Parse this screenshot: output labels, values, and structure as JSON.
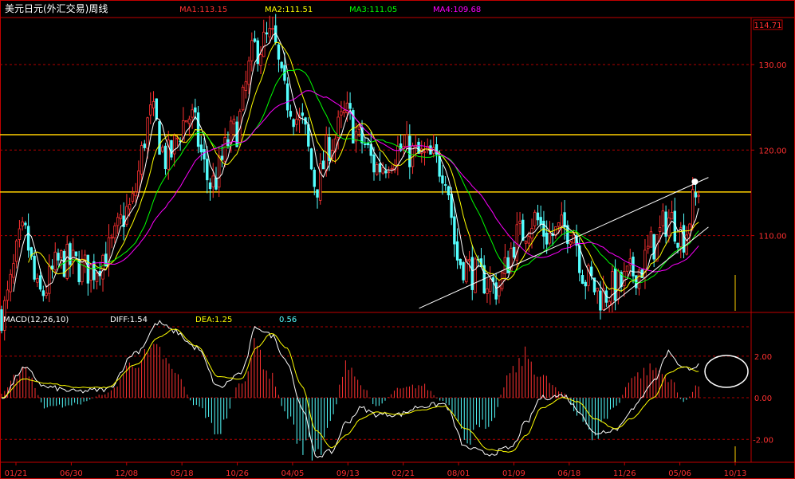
{
  "chart_data": {
    "type": "candlestick",
    "title": "美元日元(外汇交易)周线",
    "moving_averages": [
      {
        "label": "MA1:113.15",
        "value": 113.15,
        "color": "#ffffff"
      },
      {
        "label": "MA2:111.51",
        "value": 111.51,
        "color": "#ffff00"
      },
      {
        "label": "MA3:111.05",
        "value": 111.05,
        "color": "#00ff00"
      },
      {
        "label": "MA4:109.68",
        "value": 109.68,
        "color": "#ff00ff"
      }
    ],
    "price_axis": {
      "ticks": [
        "130.00",
        "120.00",
        "110.00"
      ],
      "tick_values": [
        130,
        120,
        110
      ],
      "ylim": [
        101.2,
        135.5
      ],
      "last_price": "114.71",
      "last_value": 114.71
    },
    "horizontal_lines": [
      121.8,
      115.1
    ],
    "trendlines": [
      {
        "from": [
          0.557,
          101.5
        ],
        "to": [
          0.943,
          116.8
        ]
      },
      {
        "from": [
          0.803,
          101.2
        ],
        "to": [
          0.943,
          111.0
        ]
      }
    ],
    "x_labels": [
      "01/21",
      "06/30",
      "12/08",
      "05/18",
      "10/26",
      "04/05",
      "09/13",
      "02/21",
      "08/01",
      "01/09",
      "06/18",
      "11/26",
      "05/06",
      "10/13"
    ],
    "price_keypoints": [
      [
        0,
        101
      ],
      [
        0.03,
        110
      ],
      [
        0.05,
        103
      ],
      [
        0.08,
        107
      ],
      [
        0.12,
        106
      ],
      [
        0.14,
        108
      ],
      [
        0.17,
        113
      ],
      [
        0.2,
        124
      ],
      [
        0.22,
        119
      ],
      [
        0.25,
        124
      ],
      [
        0.28,
        116
      ],
      [
        0.31,
        122
      ],
      [
        0.34,
        132
      ],
      [
        0.36,
        133
      ],
      [
        0.38,
        126
      ],
      [
        0.4,
        123
      ],
      [
        0.42,
        116
      ],
      [
        0.44,
        121
      ],
      [
        0.46,
        124
      ],
      [
        0.48,
        121
      ],
      [
        0.5,
        118
      ],
      [
        0.53,
        120
      ],
      [
        0.57,
        119
      ],
      [
        0.59,
        118
      ],
      [
        0.61,
        107
      ],
      [
        0.64,
        105
      ],
      [
        0.66,
        104
      ],
      [
        0.69,
        110
      ],
      [
        0.71,
        112
      ],
      [
        0.73,
        110
      ],
      [
        0.76,
        111
      ],
      [
        0.78,
        105
      ],
      [
        0.8,
        103
      ],
      [
        0.82,
        104
      ],
      [
        0.85,
        106
      ],
      [
        0.87,
        109
      ],
      [
        0.89,
        112
      ],
      [
        0.91,
        110
      ],
      [
        0.925,
        114
      ],
      [
        0.93,
        114.7
      ]
    ],
    "macd": {
      "label": "MACD(12,26,10)",
      "diff_label": "DIFF:1.54",
      "dea_label": "DEA:1.25",
      "macd_label": "0.56",
      "diff": 1.54,
      "dea": 1.25,
      "macd": 0.56,
      "ticks": [
        "2.00",
        "0.00",
        "-2.00"
      ],
      "tick_values": [
        2,
        0,
        -2
      ],
      "ylim": [
        -3.1,
        4.1
      ],
      "diff_keypoints": [
        [
          0,
          0
        ],
        [
          0.03,
          1.4
        ],
        [
          0.06,
          0.5
        ],
        [
          0.1,
          0.3
        ],
        [
          0.14,
          0.4
        ],
        [
          0.18,
          2.2
        ],
        [
          0.21,
          3.6
        ],
        [
          0.23,
          3.2
        ],
        [
          0.26,
          2.4
        ],
        [
          0.29,
          0.5
        ],
        [
          0.32,
          1.2
        ],
        [
          0.34,
          3.4
        ],
        [
          0.36,
          3
        ],
        [
          0.38,
          1.8
        ],
        [
          0.4,
          -0.4
        ],
        [
          0.42,
          -2.8
        ],
        [
          0.44,
          -2.6
        ],
        [
          0.46,
          -1.2
        ],
        [
          0.48,
          -0.5
        ],
        [
          0.5,
          -0.8
        ],
        [
          0.53,
          -0.8
        ],
        [
          0.56,
          -0.4
        ],
        [
          0.59,
          -0.3
        ],
        [
          0.62,
          -2.4
        ],
        [
          0.65,
          -2.7
        ],
        [
          0.68,
          -2.4
        ],
        [
          0.7,
          -1.2
        ],
        [
          0.72,
          0
        ],
        [
          0.75,
          0.1
        ],
        [
          0.77,
          -0.6
        ],
        [
          0.79,
          -1.7
        ],
        [
          0.82,
          -1.5
        ],
        [
          0.84,
          -0.6
        ],
        [
          0.87,
          0.8
        ],
        [
          0.89,
          2.2
        ],
        [
          0.91,
          1.4
        ],
        [
          0.93,
          1.54
        ]
      ],
      "dea_keypoints": [
        [
          0,
          0
        ],
        [
          0.03,
          0.9
        ],
        [
          0.06,
          0.7
        ],
        [
          0.1,
          0.5
        ],
        [
          0.14,
          0.5
        ],
        [
          0.18,
          1.6
        ],
        [
          0.21,
          2.9
        ],
        [
          0.23,
          3.3
        ],
        [
          0.26,
          2.5
        ],
        [
          0.29,
          1
        ],
        [
          0.32,
          0.9
        ],
        [
          0.34,
          2.4
        ],
        [
          0.36,
          3.1
        ],
        [
          0.38,
          2.4
        ],
        [
          0.4,
          0.6
        ],
        [
          0.42,
          -1.6
        ],
        [
          0.44,
          -2.4
        ],
        [
          0.46,
          -1.8
        ],
        [
          0.48,
          -1
        ],
        [
          0.5,
          -0.7
        ],
        [
          0.53,
          -0.8
        ],
        [
          0.56,
          -0.6
        ],
        [
          0.59,
          -0.4
        ],
        [
          0.62,
          -1.5
        ],
        [
          0.65,
          -2.5
        ],
        [
          0.68,
          -2.6
        ],
        [
          0.7,
          -1.8
        ],
        [
          0.72,
          -0.5
        ],
        [
          0.75,
          0
        ],
        [
          0.77,
          -0.2
        ],
        [
          0.79,
          -1
        ],
        [
          0.82,
          -1.5
        ],
        [
          0.84,
          -1
        ],
        [
          0.87,
          0
        ],
        [
          0.89,
          1.2
        ],
        [
          0.91,
          1.5
        ],
        [
          0.93,
          1.25
        ]
      ],
      "hist_keypoints": [
        [
          0,
          0.2
        ],
        [
          0.03,
          1.5
        ],
        [
          0.06,
          -0.5
        ],
        [
          0.1,
          -0.3
        ],
        [
          0.14,
          0.2
        ],
        [
          0.18,
          1.8
        ],
        [
          0.21,
          2.2
        ],
        [
          0.23,
          1.2
        ],
        [
          0.26,
          -0.4
        ],
        [
          0.29,
          -1.6
        ],
        [
          0.32,
          0.8
        ],
        [
          0.34,
          2.4
        ],
        [
          0.36,
          1
        ],
        [
          0.38,
          -0.8
        ],
        [
          0.4,
          -2.2
        ],
        [
          0.42,
          -2.7
        ],
        [
          0.44,
          -1
        ],
        [
          0.46,
          1.8
        ],
        [
          0.48,
          0.6
        ],
        [
          0.5,
          -0.4
        ],
        [
          0.53,
          0.4
        ],
        [
          0.56,
          0.6
        ],
        [
          0.59,
          -0.2
        ],
        [
          0.62,
          -2
        ],
        [
          0.65,
          -1.2
        ],
        [
          0.68,
          1.2
        ],
        [
          0.7,
          2
        ],
        [
          0.72,
          1
        ],
        [
          0.75,
          0.2
        ],
        [
          0.77,
          -1
        ],
        [
          0.79,
          -1.8
        ],
        [
          0.82,
          -0.4
        ],
        [
          0.84,
          1
        ],
        [
          0.87,
          1.4
        ],
        [
          0.89,
          1
        ],
        [
          0.91,
          -0.2
        ],
        [
          0.93,
          0.56
        ]
      ]
    }
  },
  "colors": {
    "up": "#ff3232",
    "down": "#54ffff",
    "frame": "#c00000",
    "grid": "#b00000",
    "level": "#ffd000"
  }
}
